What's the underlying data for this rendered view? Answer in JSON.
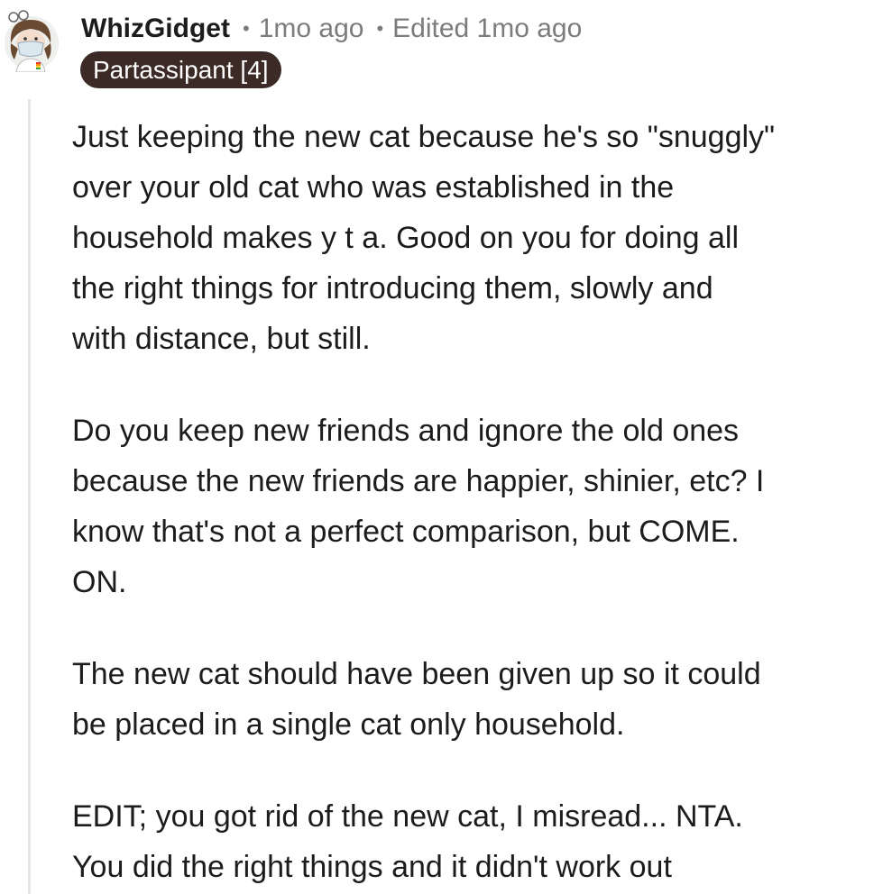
{
  "comment": {
    "author": "WhizGidget",
    "separator_1": "•",
    "timestamp": "1mo ago",
    "separator_2": "•",
    "edited": "Edited 1mo ago",
    "flair": "Partassipant [4]",
    "avatar_icon": "cartoon-avatar-icon",
    "paragraphs": [
      "Just keeping the new cat because he's so \"snuggly\"\nover your old cat who was established in the\nhousehold makes y t a. Good on you for doing all\nthe right things for introducing them, slowly and\nwith distance, but still.",
      "Do you keep new friends and ignore the old ones\nbecause the new friends are happier, shinier, etc? I\nknow that's not a perfect comparison, but COME.\nON.",
      "The new cat should have been given up so it could\nbe placed in a single cat only household.",
      "EDIT; you got rid of the new cat, I misread... NTA.\nYou did the right things and it didn't work out"
    ]
  },
  "colors": {
    "flair_bg": "#3b2a26",
    "meta_gray": "#7c7c7c",
    "text": "#1c1c1c",
    "thread_line": "#e5e5e5"
  }
}
